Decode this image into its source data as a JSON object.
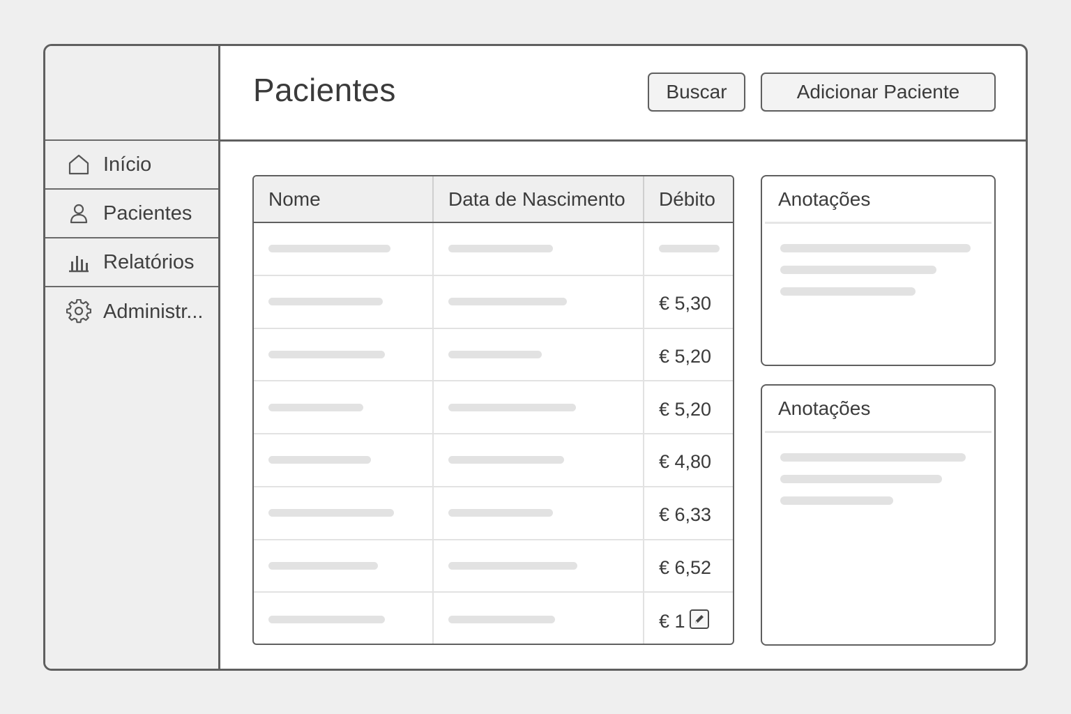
{
  "sidebar": {
    "items": [
      {
        "label": "Início",
        "icon": "home-icon"
      },
      {
        "label": "Pacientes",
        "icon": "user-icon"
      },
      {
        "label": "Relatórios",
        "icon": "bar-chart-icon"
      },
      {
        "label": "Administr...",
        "icon": "gear-icon"
      }
    ]
  },
  "header": {
    "title": "Pacientes",
    "search_label": "Buscar",
    "add_label": "Adicionar Paciente"
  },
  "table": {
    "columns": [
      "Nome",
      "Data de Nascimento",
      "Débito"
    ],
    "rows": [
      {
        "debit": ""
      },
      {
        "debit": "€ 5,30"
      },
      {
        "debit": "€ 5,20"
      },
      {
        "debit": "€ 5,20"
      },
      {
        "debit": "€ 4,80"
      },
      {
        "debit": "€ 6,33"
      },
      {
        "debit": "€ 6,52"
      },
      {
        "debit": "€ 1"
      }
    ]
  },
  "notes": [
    {
      "title": "Anotações"
    },
    {
      "title": "Anotações"
    }
  ],
  "colors": {
    "border": "#5f5f5f",
    "sidebar_bg": "#efefef",
    "placeholder": "#e2e2e2"
  }
}
